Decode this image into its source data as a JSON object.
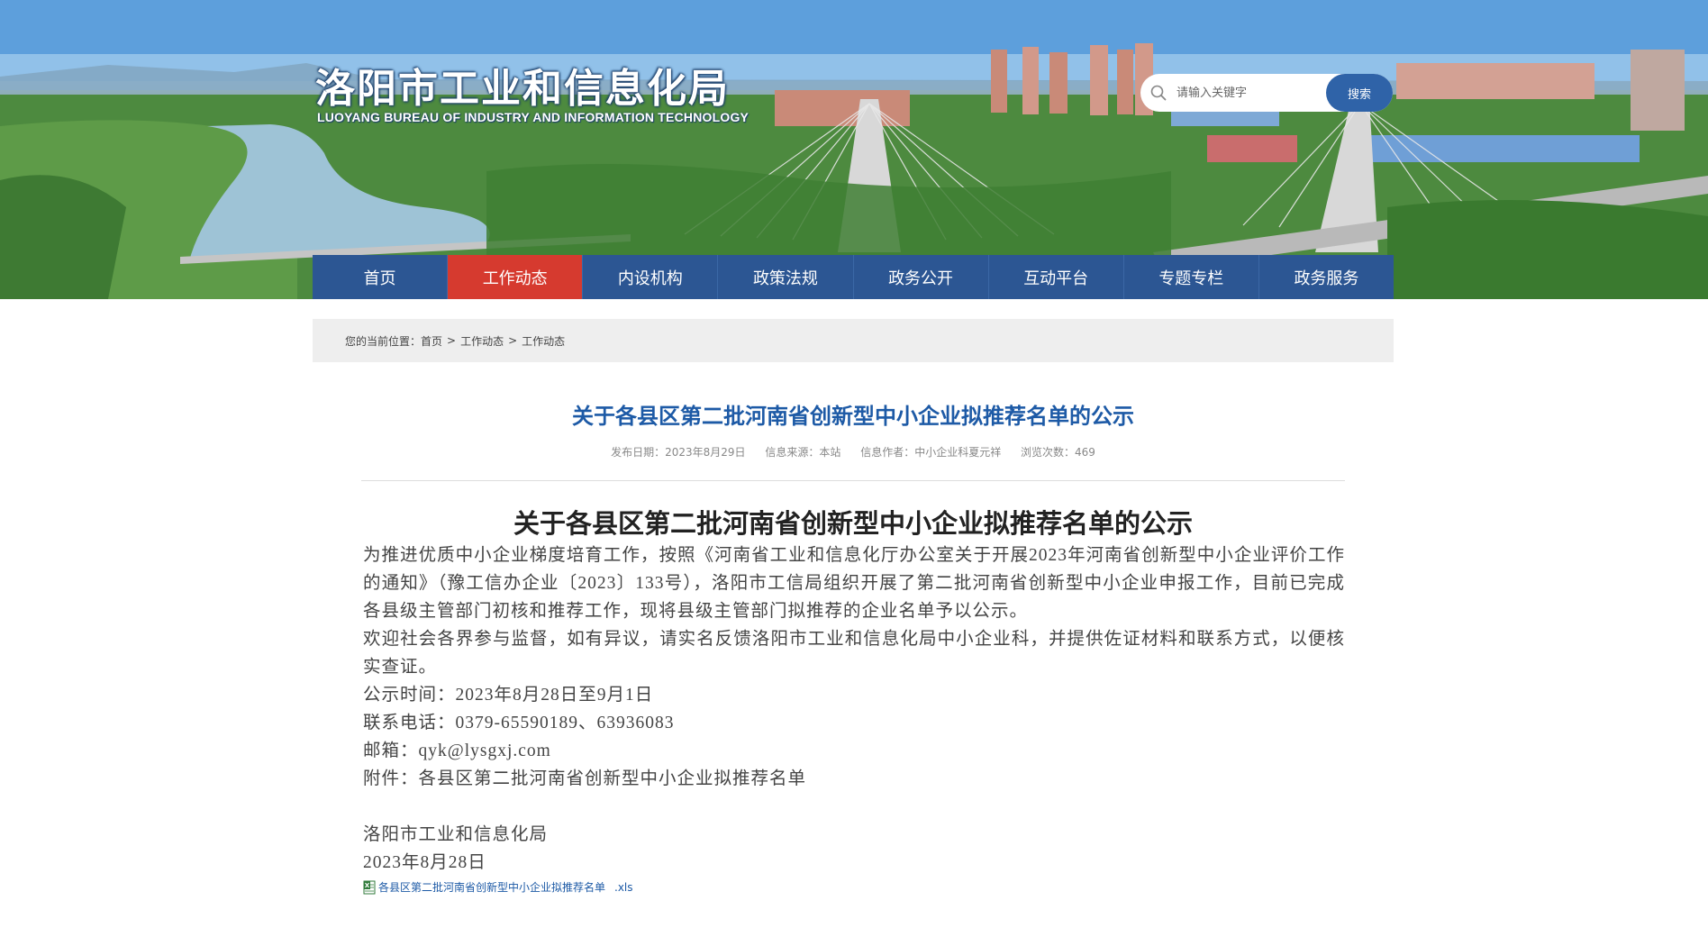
{
  "header": {
    "title": "洛阳市工业和信息化局",
    "subtitle": "LUOYANG BUREAU OF INDUSTRY AND INFORMATION TECHNOLOGY",
    "banner_icon": "city-bridge-banner"
  },
  "search": {
    "placeholder": "请输入关键字",
    "button_label": "搜索",
    "icon": "search-icon"
  },
  "nav": {
    "items": [
      {
        "label": "首页"
      },
      {
        "label": "工作动态",
        "active": true
      },
      {
        "label": "内设机构"
      },
      {
        "label": "政策法规"
      },
      {
        "label": "政务公开"
      },
      {
        "label": "互动平台"
      },
      {
        "label": "专题专栏"
      },
      {
        "label": "政务服务"
      }
    ]
  },
  "breadcrumb": {
    "prefix": "您的当前位置：",
    "items": [
      "首页",
      "工作动态",
      "工作动态"
    ],
    "separator": ">"
  },
  "article": {
    "title": "关于各县区第二批河南省创新型中小企业拟推荐名单的公示",
    "meta": {
      "date": "发布日期：2023年8月29日",
      "source": "信息来源：本站",
      "author": "信息作者：中小企业科夏元祥",
      "views": "浏览次数：469"
    },
    "doc_title": "关于各县区第二批河南省创新型中小企业拟推荐名单的公示",
    "paragraphs": [
      "为推进优质中小企业梯度培育工作，按照《河南省工业和信息化厅办公室关于开展2023年河南省创新型中小企业评价工作的通知》（豫工信办企业〔2023〕133号），洛阳市工信局组织开展了第二批河南省创新型中小企业申报工作，目前已完成各县级主管部门初核和推荐工作，现将县级主管部门拟推荐的企业名单予以公示。",
      "欢迎社会各界参与监督，如有异议，请实名反馈洛阳市工业和信息化局中小企业科，并提供佐证材料和联系方式，以便核实查证。",
      "公示时间：2023年8月28日至9月1日",
      "联系电话：0379-65590189、63936083",
      "邮箱：qyk@lysgxj.com",
      "附件：各县区第二批河南省创新型中小企业拟推荐名单"
    ],
    "signature": {
      "org": "洛阳市工业和信息化局",
      "date": "2023年8月28日"
    },
    "attachment": {
      "name": "各县区第二批河南省创新型中小企业拟推荐名单",
      "ext": ".xls",
      "icon": "excel-file-icon"
    }
  },
  "colors": {
    "nav_bg": "#2c5693",
    "nav_active": "#d63a2f",
    "title_blue": "#1d5aa6",
    "search_button": "#2f63a8"
  }
}
